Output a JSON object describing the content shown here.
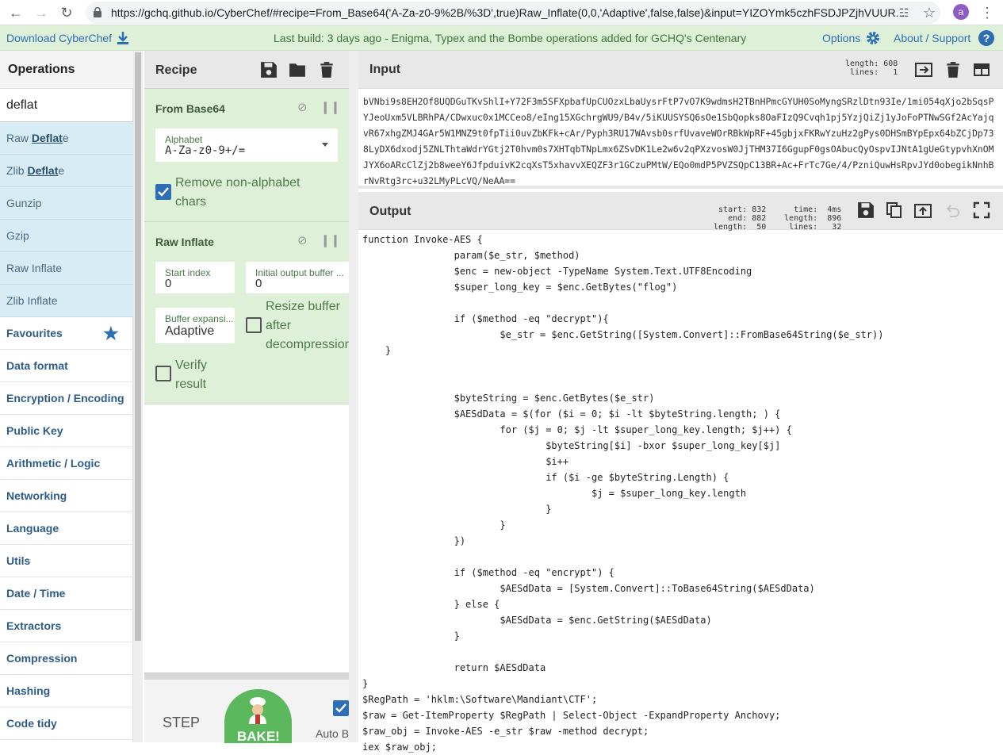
{
  "browser": {
    "url": "https://gchq.github.io/CyberChef/#recipe=From_Base64('A-Za-z0-9%2B/%3D',true)Raw_Inflate(0,0,'Adaptive',false,false)&input=YIZOYmk5czhFSDJPZjhVUUR...",
    "profile_initial": "a"
  },
  "banner": {
    "download": "Download CyberChef",
    "build": "Last build: 3 days ago - Enigma, Typex and the Bombe operations added for GCHQ's Centenary",
    "options": "Options",
    "about": "About / Support"
  },
  "operations": {
    "title": "Operations",
    "search_value": "deflat",
    "results": [
      {
        "pre": "Raw ",
        "match": "Deflat",
        "post": "e"
      },
      {
        "pre": "Zlib ",
        "match": "Deflat",
        "post": "e"
      },
      {
        "pre": "Gunzip",
        "match": "",
        "post": ""
      },
      {
        "pre": "Gzip",
        "match": "",
        "post": ""
      },
      {
        "pre": "Raw Inflate",
        "match": "",
        "post": ""
      },
      {
        "pre": "Zlib Inflate",
        "match": "",
        "post": ""
      }
    ],
    "categories": [
      "Favourites",
      "Data format",
      "Encryption / Encoding",
      "Public Key",
      "Arithmetic / Logic",
      "Networking",
      "Language",
      "Utils",
      "Date / Time",
      "Extractors",
      "Compression",
      "Hashing",
      "Code tidy"
    ]
  },
  "recipe": {
    "title": "Recipe",
    "from_base64": {
      "title": "From Base64",
      "alphabet_label": "Alphabet",
      "alphabet_value": "A-Za-z0-9+/=",
      "remove_label": "Remove non-alphabet chars",
      "remove_checked": true
    },
    "raw_inflate": {
      "title": "Raw Inflate",
      "start_index_label": "Start index",
      "start_index_value": "0",
      "initial_buffer_label": "Initial output buffer ...",
      "initial_buffer_value": "0",
      "buffer_expansion_label": "Buffer expansi...",
      "buffer_expansion_value": "Adaptive",
      "resize_label": "Resize buffer after decompression",
      "verify_label": "Verify result"
    },
    "step_label": "STEP",
    "bake_label": "BAKE!",
    "auto_bake_label": "Auto B"
  },
  "input": {
    "title": "Input",
    "length_label": "length:",
    "length_value": "608",
    "lines_label": "lines:",
    "lines_value": "1",
    "text": "bVNbi9s8EH2Of8UQDGuTKvShlI+Y72F3m5SFXpbafUpCUOzxLbaUysrFtP7vO7K9wdmsH2TBnHPmcGYUH0SoMyngSRzlDtn93Ie/1mi054qXjo2bSqsPYJeoUxm5VLBRhPA/CDwxuc0x1MCCeo8/eIng15XGchrgWU9/B4v/5iKUUSYSQ6sOe1SbQopks8OaFIzQ9Cvqh1pj5YzjQiZj1yJoFoPTNwSGf2AcYajqvR67xhgZMJ4GAr5W1MNZ9t0fpTii0uvZbKFk+cAr/Pyph3RU17WAvsb0srfUvaveWOrRBkWpRF+45gbjxFKRwYzuHz2gPys0DHSmBYpEpx64bZCjDp738LyDX6dxodj5ZNLThtaWdrYGtj2T0hvm0s7XHTqbTNpLmx6ZSvDK1Le2w6v2qPXzvosW0JjTHM37I6GgupF0gsOAbucQyOspvIJNtA1gUeGtypvhXnOMJYX6oARcClZj2b8weeY6JfpduivK2cqXsT5xhavvXEQZF3r1GCzuPMtW/EQo0mdP5PVZSQpC13BR+Ac+FrTc7Ge/4/PzniQuwHsRpvJYd0obegikNnhBrNvRtg3rc+u32LMyPLcVQ/NeAA=="
  },
  "output": {
    "title": "Output",
    "start_label": "start:",
    "start_value": "832",
    "end_label": "end:",
    "end_value": "882",
    "sel_length_label": "length:",
    "sel_length_value": "50",
    "time_label": "time:",
    "time_value": "4ms",
    "length_label": "length:",
    "length_value": "896",
    "lines_label": "lines:",
    "lines_value": "32",
    "text": "function Invoke-AES {\n                param($e_str, $method)\n                $enc = new-object -TypeName System.Text.UTF8Encoding\n                $super_long_key = $enc.GetBytes(\"flog\")\n\n                if ($method -eq \"decrypt\"){\n                        $e_str = $enc.GetString([System.Convert]::FromBase64String($e_str))\n    }\n\n\n                $byteString = $enc.GetBytes($e_str)\n                $AESdData = $(for ($i = 0; $i -lt $byteString.length; ) {\n                        for ($j = 0; $j -lt $super_long_key.length; $j++) {\n                                $byteString[$i] -bxor $super_long_key[$j]\n                                $i++\n                                if ($i -ge $byteString.Length) {\n                                        $j = $super_long_key.length\n                                }\n                        }\n                })\n\n                if ($method -eq \"encrypt\") {\n                        $AESdData = [System.Convert]::ToBase64String($AESdData)\n                } else {\n                        $AESdData = $enc.GetString($AESdData)\n                }\n\n                return $AESdData\n}\n$RegPath = 'hklm:\\Software\\Mandiant\\CTF';\n$raw = Get-ItemProperty $RegPath | Select-Object -ExpandProperty Anchovy;\n$raw_obj = Invoke-AES -e_str $raw -method decrypt;\niex $raw_obj;"
  }
}
